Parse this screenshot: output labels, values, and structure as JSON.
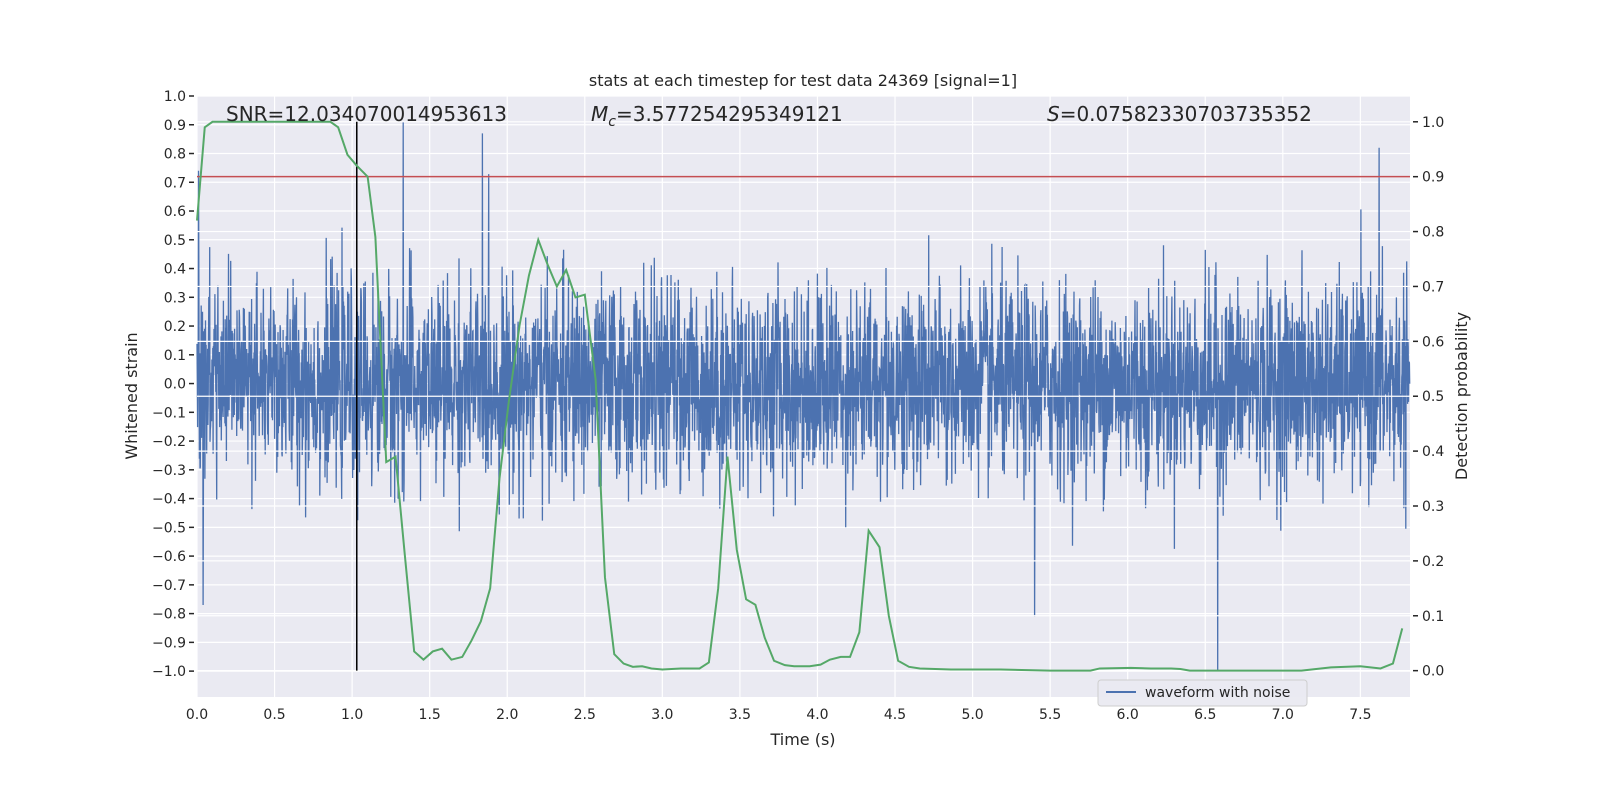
{
  "chart_data": {
    "type": "line",
    "title": "stats at each timestep for test data 24369 [signal=1]",
    "xlabel": "Time (s)",
    "ylabel": "Whitened strain",
    "y2label": "Detection probability",
    "xlim": [
      0.0,
      7.82
    ],
    "ylim": [
      -1.09,
      1.0
    ],
    "y2lim": [
      -0.048,
      1.047
    ],
    "xticks": [
      "0.0",
      "0.5",
      "1.0",
      "1.5",
      "2.0",
      "2.5",
      "3.0",
      "3.5",
      "4.0",
      "4.5",
      "5.0",
      "5.5",
      "6.0",
      "6.5",
      "7.0",
      "7.5"
    ],
    "yticks": [
      "−1.0",
      "−0.9",
      "−0.8",
      "−0.7",
      "−0.6",
      "−0.5",
      "−0.4",
      "−0.3",
      "−0.2",
      "−0.1",
      "0.0",
      "0.1",
      "0.2",
      "0.3",
      "0.4",
      "0.5",
      "0.6",
      "0.7",
      "0.8",
      "0.9",
      "1.0"
    ],
    "y2ticks": [
      "0.0",
      "0.1",
      "0.2",
      "0.3",
      "0.4",
      "0.5",
      "0.6",
      "0.7",
      "0.8",
      "0.9",
      "1.0"
    ],
    "grid": true,
    "annotations": {
      "snr": "SNR=12.034070014953613",
      "mc_symbol": "M",
      "mc_sub": "c",
      "mc_value": "=3.577254295349121",
      "s_symbol": "S",
      "s_value": "=0.07582330703735352"
    },
    "legend": {
      "placement": "lower-right",
      "entries": [
        "waveform with noise"
      ]
    },
    "colors": {
      "waveform": "#4c72b0",
      "probability": "#55a868",
      "threshold": "#c44e52",
      "marker": "#000000",
      "background": "#eaeaf2"
    },
    "threshold_probability": 0.9,
    "marker_time": 1.03,
    "waveform_notable_peaks": [
      [
        0.01,
        0.74
      ],
      [
        1.33,
        0.91
      ],
      [
        1.84,
        0.87
      ],
      [
        6.58,
        -1.0
      ],
      [
        7.62,
        0.82
      ],
      [
        0.04,
        -0.77
      ],
      [
        5.4,
        -0.81
      ]
    ],
    "series": [
      {
        "name": "waveform with noise",
        "axis": "left",
        "note_noise_std": 0.17
      },
      {
        "axis": "right",
        "x": [
          0.0,
          0.05,
          0.1,
          0.86,
          0.91,
          0.97,
          1.03,
          1.1,
          1.15,
          1.22,
          1.28,
          1.34,
          1.4,
          1.46,
          1.52,
          1.58,
          1.64,
          1.71,
          1.77,
          1.83,
          1.89,
          1.95,
          2.01,
          2.08,
          2.14,
          2.2,
          2.26,
          2.32,
          2.38,
          2.44,
          2.5,
          2.57,
          2.63,
          2.69,
          2.75,
          2.81,
          2.87,
          2.93,
          3.0,
          3.12,
          3.24,
          3.3,
          3.36,
          3.42,
          3.48,
          3.54,
          3.6,
          3.66,
          3.72,
          3.79,
          3.85,
          3.95,
          4.02,
          4.08,
          4.15,
          4.21,
          4.27,
          4.33,
          4.4,
          4.46,
          4.52,
          4.59,
          4.66,
          4.86,
          5.18,
          5.5,
          5.76,
          5.82,
          6.02,
          6.15,
          6.28,
          6.34,
          6.4,
          6.5,
          7.12,
          7.31,
          7.5,
          7.63,
          7.71,
          7.77
        ],
        "values": [
          0.82,
          0.99,
          1.0,
          1.0,
          0.99,
          0.94,
          0.92,
          0.9,
          0.79,
          0.38,
          0.39,
          0.21,
          0.035,
          0.02,
          0.035,
          0.04,
          0.02,
          0.025,
          0.055,
          0.09,
          0.15,
          0.35,
          0.49,
          0.63,
          0.72,
          0.785,
          0.74,
          0.7,
          0.73,
          0.68,
          0.685,
          0.53,
          0.17,
          0.03,
          0.013,
          0.007,
          0.008,
          0.004,
          0.002,
          0.004,
          0.004,
          0.015,
          0.15,
          0.39,
          0.22,
          0.13,
          0.12,
          0.06,
          0.018,
          0.01,
          0.008,
          0.008,
          0.011,
          0.02,
          0.025,
          0.025,
          0.07,
          0.255,
          0.225,
          0.1,
          0.018,
          0.007,
          0.004,
          0.002,
          0.002,
          0.0,
          0.0,
          0.004,
          0.005,
          0.004,
          0.004,
          0.003,
          0.0,
          0.0,
          0.0,
          0.006,
          0.008,
          0.004,
          0.013,
          0.077
        ]
      }
    ]
  }
}
